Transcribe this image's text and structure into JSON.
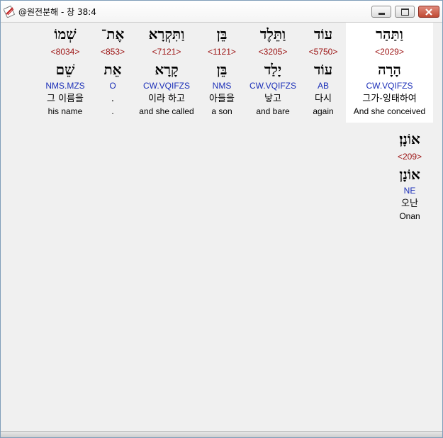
{
  "window": {
    "title": "@원전분해 - 창 38:4"
  },
  "words": [
    {
      "hebrew": "וַתַּהַר",
      "strong": "<2029>",
      "lemma": "הָרָה",
      "morph": "CW.VQIFZS",
      "korean": "그가-잉태하여",
      "english": "And she conceived",
      "selected": true
    },
    {
      "hebrew": "עוֹד",
      "strong": "<5750>",
      "lemma": "עוֹד",
      "morph": "AB",
      "korean": "다시",
      "english": "again",
      "selected": false
    },
    {
      "hebrew": "וַתֵּלֶד",
      "strong": "<3205>",
      "lemma": "יָלַד",
      "morph": "CW.VQIFZS",
      "korean": "낳고",
      "english": "and bare",
      "selected": false
    },
    {
      "hebrew": "בֵּן",
      "strong": "<1121>",
      "lemma": "בֵּן",
      "morph": "NMS",
      "korean": "아들을",
      "english": "a son",
      "selected": false
    },
    {
      "hebrew": "וַתִּקְרָא",
      "strong": "<7121>",
      "lemma": "קָרָא",
      "morph": "CW.VQIFZS",
      "korean": "이라 하고",
      "english": "and she called",
      "selected": false
    },
    {
      "hebrew": "אֶת־",
      "strong": "<853>",
      "lemma": "אֵת",
      "morph": "O",
      "korean": ".",
      "english": ".",
      "selected": false
    },
    {
      "hebrew": "שְׁמוֹ",
      "strong": "<8034>",
      "lemma": "שֵׁם",
      "morph": "NMS.MZS",
      "korean": "그 이름을",
      "english": "his name",
      "selected": false
    },
    {
      "hebrew": "אוֹנָן׃",
      "strong": "<209>",
      "lemma": "אוֹנָן",
      "morph": "NE",
      "korean": "오난",
      "english": "Onan",
      "selected": false
    }
  ]
}
